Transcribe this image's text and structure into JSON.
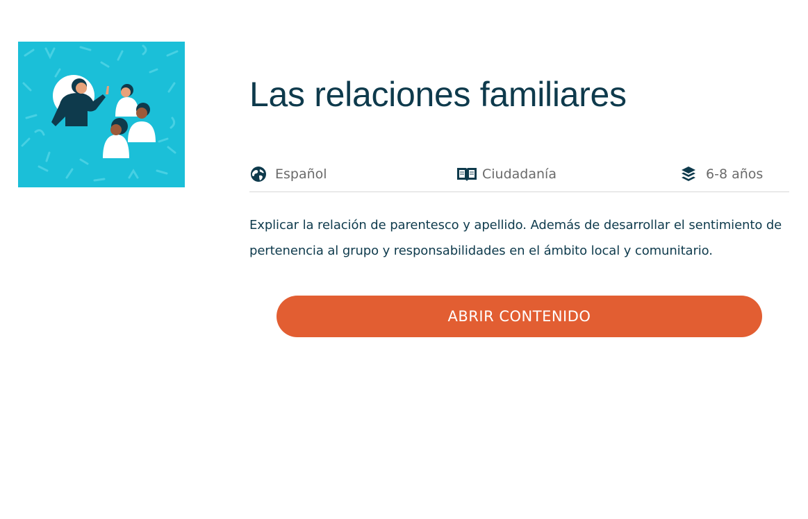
{
  "card": {
    "title": "Las relaciones familiares",
    "meta": {
      "language": {
        "icon": "globe-icon",
        "label": "Español"
      },
      "subject": {
        "icon": "open-book-icon",
        "label": "Ciudadanía"
      },
      "age": {
        "icon": "layers-icon",
        "label": "6-8 años"
      }
    },
    "description": "Explicar la relación de parentesco y apellido. Además de desarrollar el sentimiento de pertenencia al grupo y responsabilidades en el ámbito local y comunitario.",
    "button_label": "ABRIR CONTENIDO",
    "thumbnail": {
      "icon": "family-group-illustration"
    }
  },
  "colors": {
    "title_text": "#0e3a4c",
    "meta_text": "#6a6a6a",
    "button_bg": "#e25e32",
    "thumbnail_bg": "#1bbfd8"
  }
}
